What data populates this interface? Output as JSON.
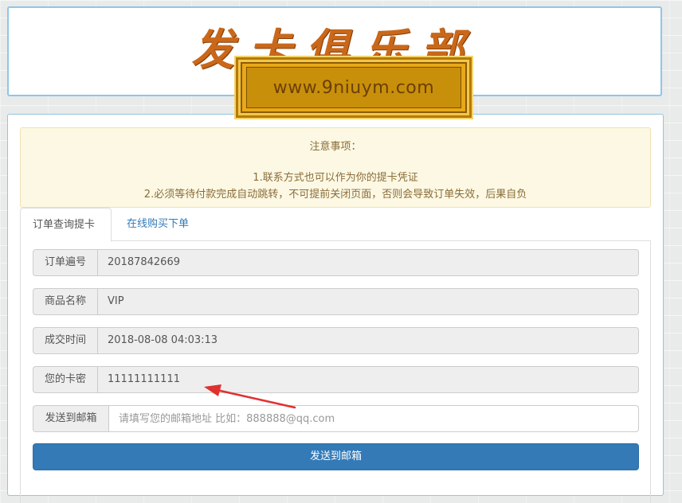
{
  "header": {
    "brand_text": "发卡俱乐部",
    "logo_url_text": "www.9niuym.com"
  },
  "notice": {
    "title": "注意事项：",
    "line1": "1.联系方式也可以作为你的提卡凭证",
    "line2": "2.必须等待付款完成自动跳转，不可提前关闭页面，否则会导致订单失效，后果自负"
  },
  "tabs": {
    "query_label": "订单查询提卡",
    "buy_label": "在线购买下单"
  },
  "order": {
    "order_no_label": "订单遍号",
    "order_no_value": "20187842669",
    "product_label": "商品名称",
    "product_value": "VIP",
    "time_label": "成交时间",
    "time_value": "2018-08-08 04:03:13",
    "card_label": "您的卡密",
    "card_value": "11111111111",
    "email_label": "发送到邮箱",
    "email_placeholder": "请填写您的邮箱地址 比如：888888@qq.com",
    "submit_label": "发送到邮箱"
  },
  "colors": {
    "primary_blue": "#337ab7",
    "annotation_red": "#e03030",
    "notice_bg": "#fcf8e3",
    "brand_orange": "#c9681a"
  }
}
